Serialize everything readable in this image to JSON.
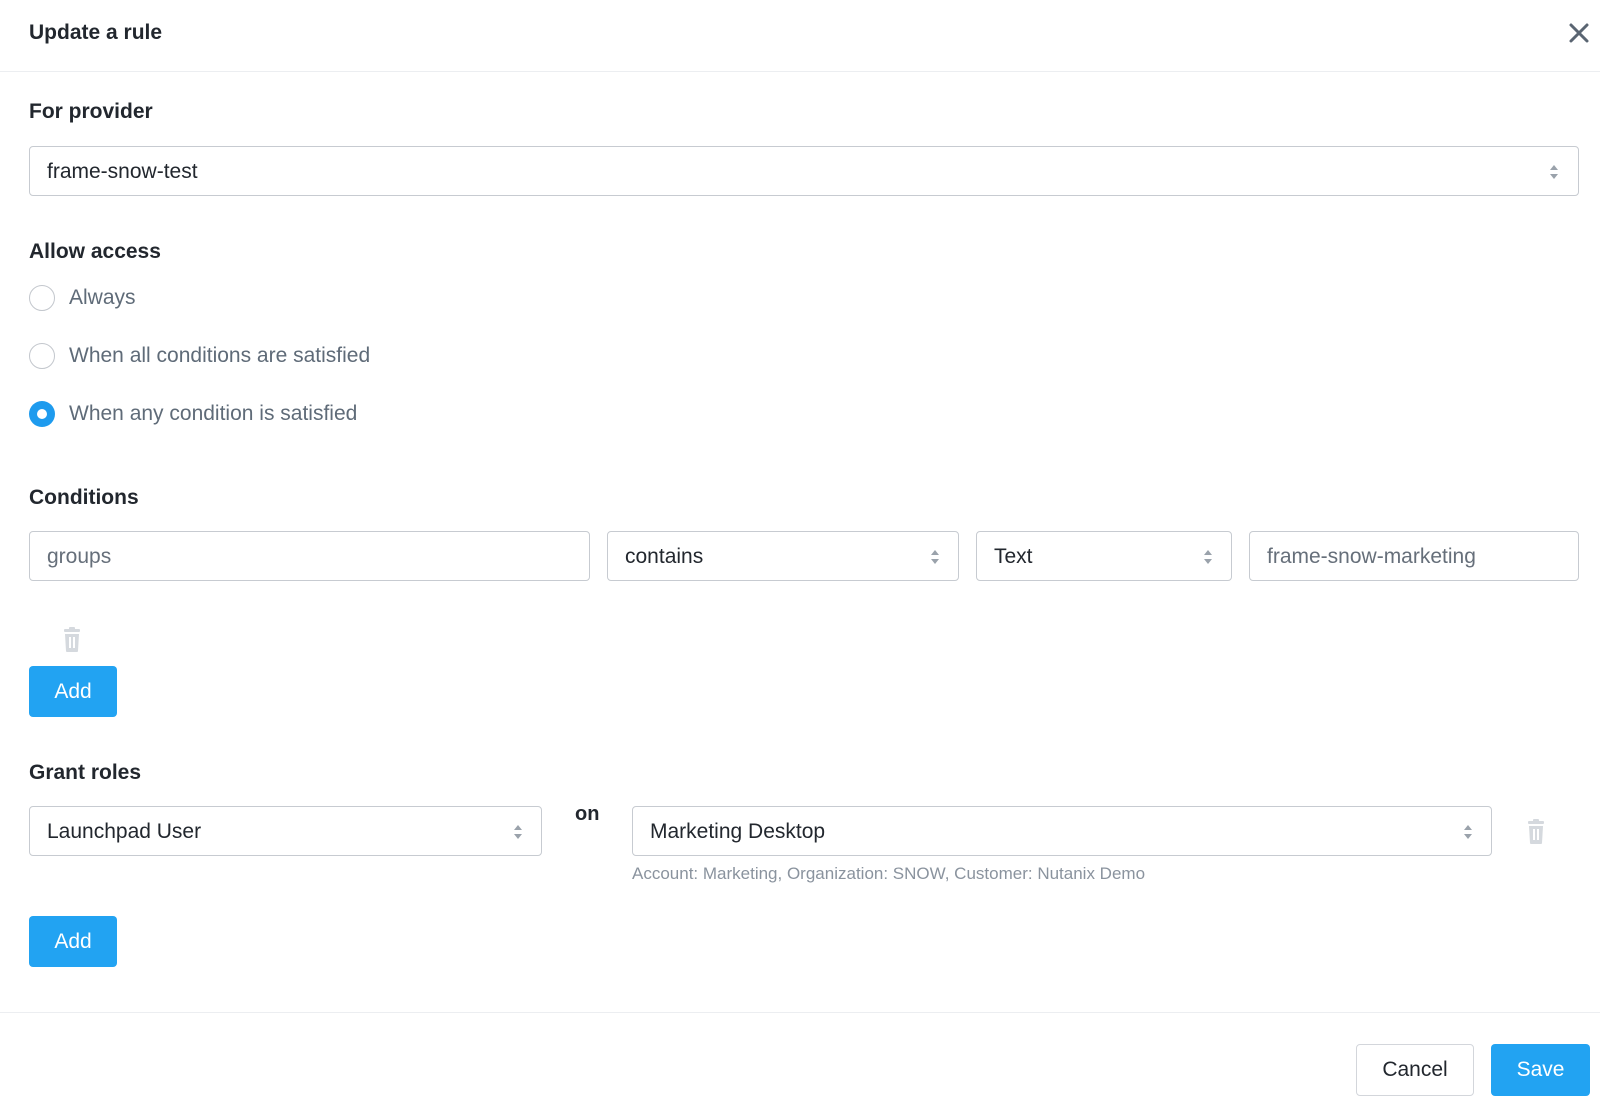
{
  "dialog": {
    "title": "Update a rule"
  },
  "provider": {
    "label": "For provider",
    "value": "frame-snow-test"
  },
  "access": {
    "label": "Allow access",
    "options": [
      {
        "label": "Always",
        "checked": false
      },
      {
        "label": "When all conditions are satisfied",
        "checked": false
      },
      {
        "label": "When any condition is satisfied",
        "checked": true
      }
    ]
  },
  "conditions": {
    "label": "Conditions",
    "rows": [
      {
        "field": "groups",
        "operator": "contains",
        "type": "Text",
        "value": "frame-snow-marketing"
      }
    ],
    "add_label": "Add"
  },
  "grant_roles": {
    "label": "Grant roles",
    "rows": [
      {
        "role": "Launchpad User",
        "connector": "on",
        "target": "Marketing Desktop",
        "target_hint": "Account: Marketing, Organization: SNOW, Customer: Nutanix Demo"
      }
    ],
    "add_label": "Add"
  },
  "footer": {
    "cancel_label": "Cancel",
    "save_label": "Save"
  },
  "colors": {
    "primary": "#22a3f2",
    "radio_checked": "#1e9bee",
    "border": "#c7cbd1",
    "text": "#22272e",
    "muted_text": "#5f6b78"
  }
}
